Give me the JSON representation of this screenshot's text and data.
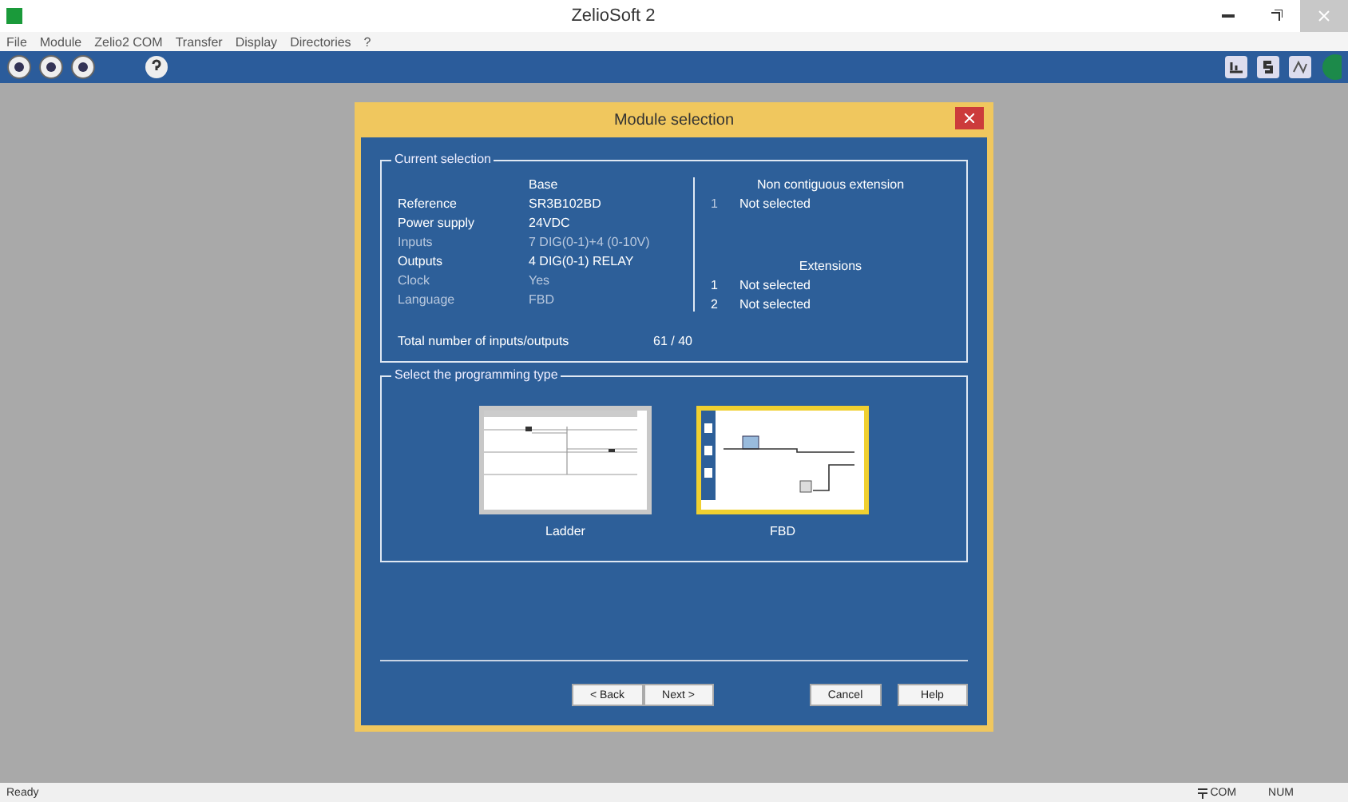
{
  "window": {
    "title": "ZelioSoft 2"
  },
  "menu": [
    "File",
    "Module",
    "Zelio2 COM",
    "Transfer",
    "Display",
    "Directories",
    "?"
  ],
  "dialog": {
    "title": "Module selection",
    "current_selection": {
      "legend": "Current selection",
      "base_heading": "Base",
      "rows": [
        {
          "label": "Reference",
          "value": "SR3B102BD",
          "dimmed": false
        },
        {
          "label": "Power supply",
          "value": "24VDC",
          "dimmed": false
        },
        {
          "label": "Inputs",
          "value": "7 DIG(0-1)+4 (0-10V)",
          "dimmed": true
        },
        {
          "label": "Outputs",
          "value": "4 DIG(0-1) RELAY",
          "dimmed": false
        },
        {
          "label": "Clock",
          "value": "Yes",
          "dimmed": true
        },
        {
          "label": "Language",
          "value": "FBD",
          "dimmed": true
        }
      ],
      "total_label": "Total number of inputs/outputs",
      "total_value": "61 / 40",
      "non_contiguous_heading": "Non contiguous extension",
      "non_contiguous": [
        {
          "index": "1",
          "value": "Not selected"
        }
      ],
      "extensions_heading": "Extensions",
      "extensions": [
        {
          "index": "1",
          "value": "Not selected"
        },
        {
          "index": "2",
          "value": "Not selected"
        }
      ]
    },
    "programming": {
      "legend": "Select the programming type",
      "types": [
        {
          "kind": "ladder",
          "label": "Ladder",
          "selected": false
        },
        {
          "kind": "fbd",
          "label": "FBD",
          "selected": true
        }
      ]
    },
    "buttons": [
      "< Back",
      "Next >",
      "Cancel",
      "Help"
    ]
  },
  "status_bar": {
    "left": "Ready",
    "com": "COM",
    "num": "NUM"
  }
}
